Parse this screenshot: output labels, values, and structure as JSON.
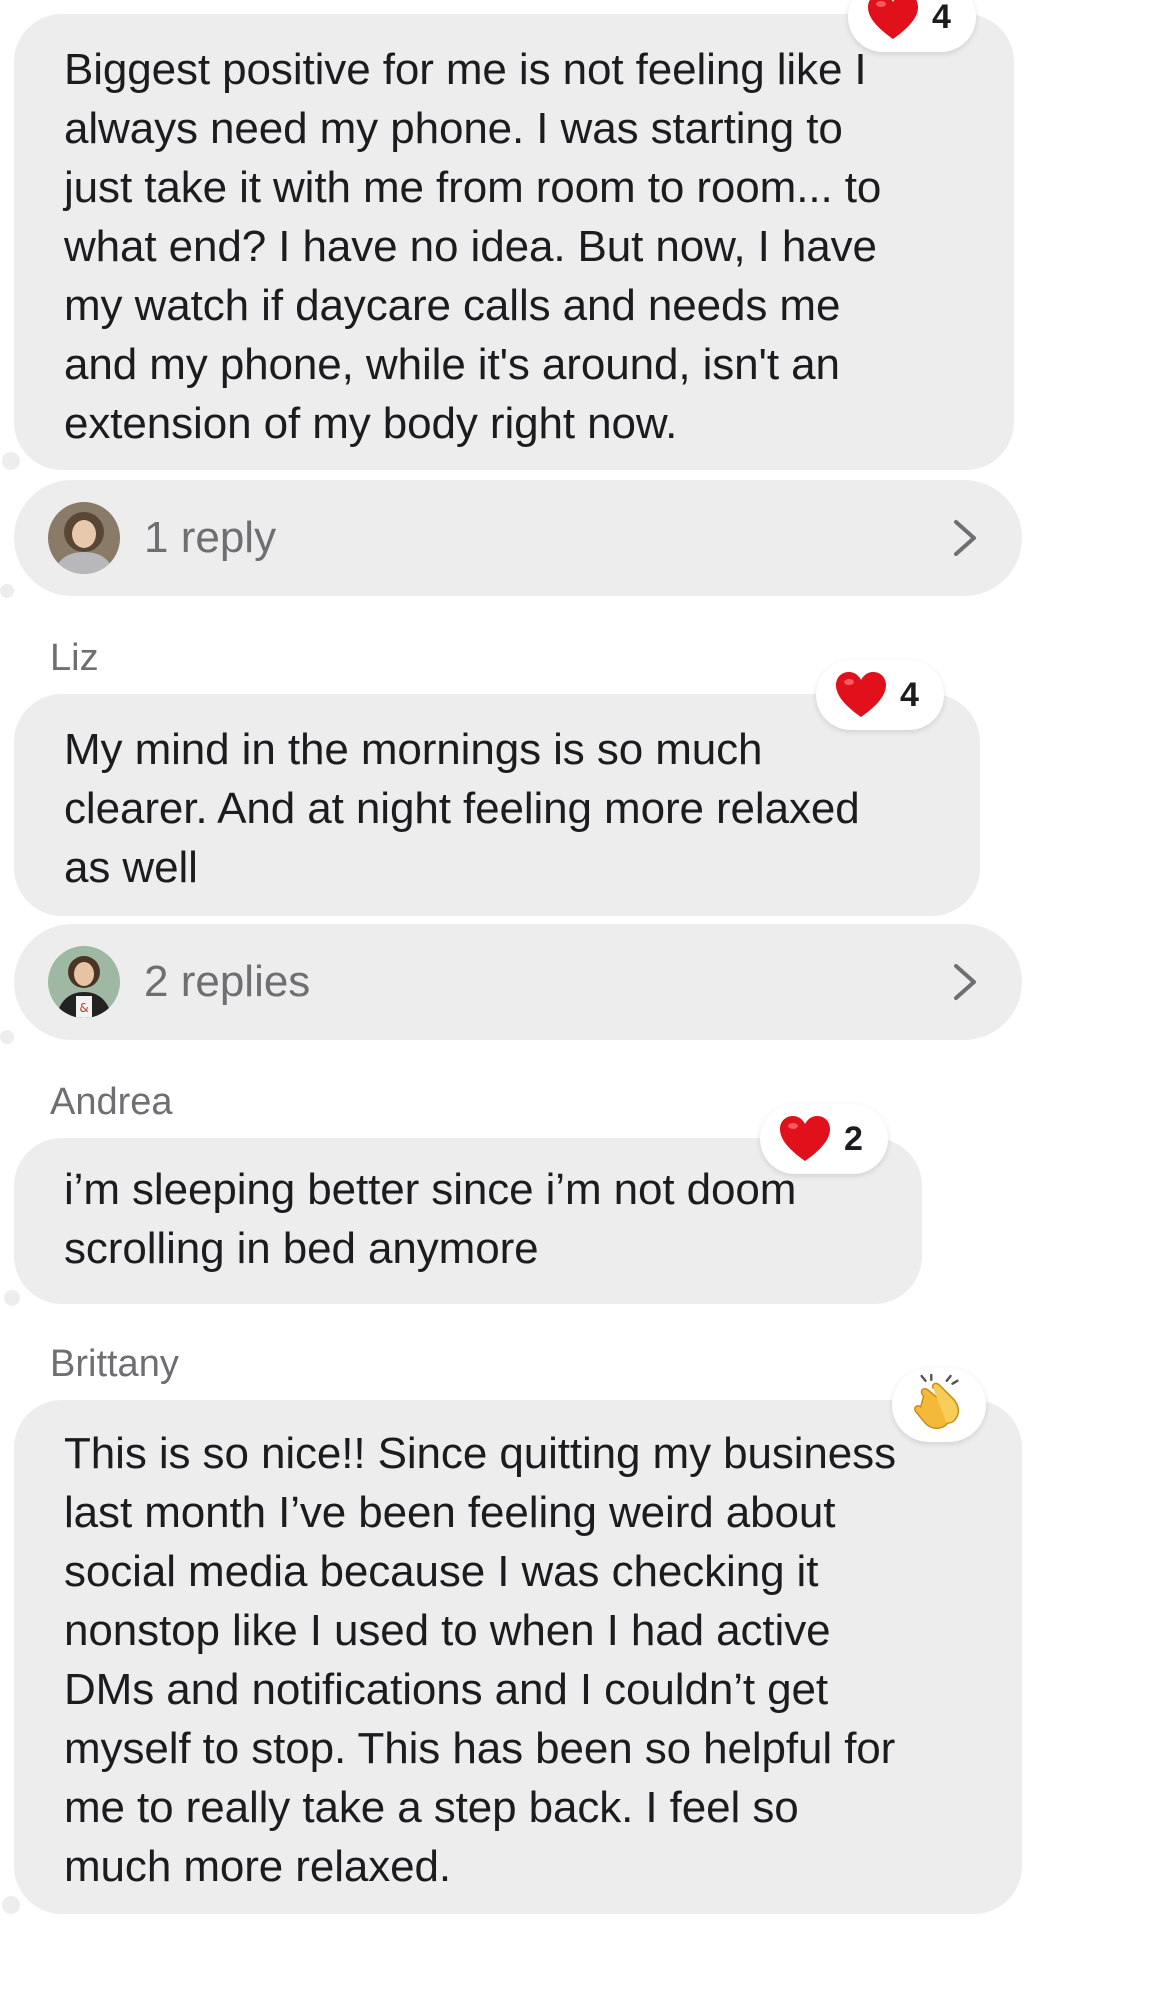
{
  "colors": {
    "bubble": "#ededed",
    "text": "#1c1c1e",
    "secondary_text": "#6e6e73",
    "heart": "#e0111a",
    "clap": "#f5c542"
  },
  "messages": [
    {
      "sender": "",
      "text": "Biggest positive for me is not feeling like I\nalways need my phone. I was starting to\njust take it with me from room to room... to\nwhat end? I have no idea. But now, I have\nmy watch if daycare calls and needs me\nand my phone, while it's around, isn't an\nextension of my body right now.",
      "reaction": {
        "icon": "heart-icon",
        "count": "4"
      },
      "replies": {
        "label": "1 reply",
        "avatar": "avatar"
      }
    },
    {
      "sender": "Liz",
      "text": "My mind in the mornings is so much\nclearer. And at night feeling more relaxed\nas well",
      "reaction": {
        "icon": "heart-icon",
        "count": "4"
      },
      "replies": {
        "label": "2 replies",
        "avatar": "avatar"
      }
    },
    {
      "sender": "Andrea",
      "text": "i’m sleeping better since i’m not doom\nscrolling in bed anymore",
      "reaction": {
        "icon": "heart-icon",
        "count": "2"
      }
    },
    {
      "sender": "Brittany",
      "text": "This is so nice!! Since quitting my business\nlast month I’ve been feeling weird about\nsocial media because I was checking it\nnonstop like I used to when I had active\nDMs and notifications and I couldn’t get\nmyself to stop. This has been so helpful for\nme to really take a step back. I feel so\nmuch more relaxed.",
      "reaction": {
        "icon": "clapping-hands-icon",
        "count": ""
      }
    }
  ]
}
